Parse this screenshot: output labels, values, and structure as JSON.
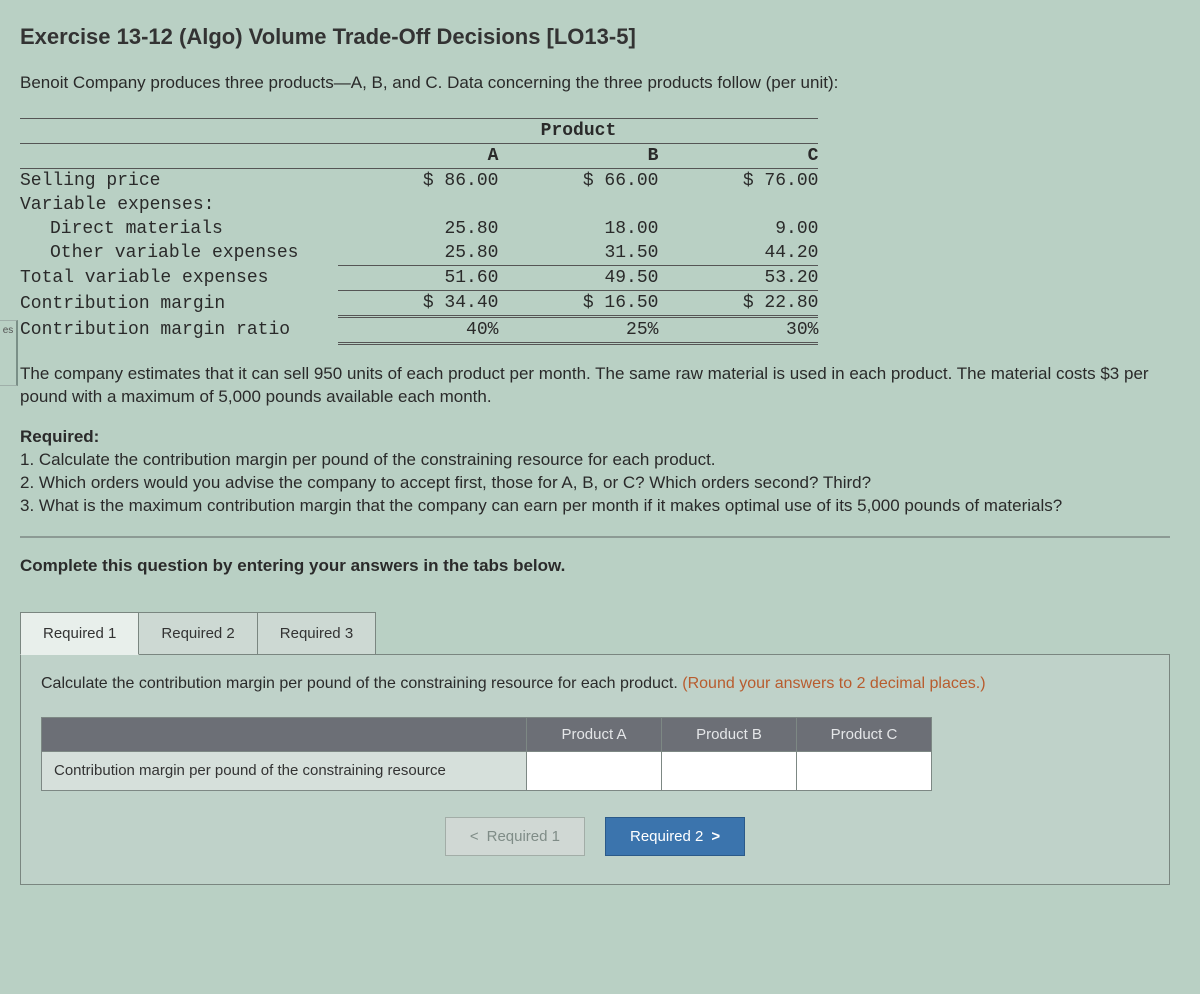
{
  "left_tab_text": "es",
  "title": "Exercise 13-12 (Algo) Volume Trade-Off Decisions [LO13-5]",
  "lead": "Benoit Company produces three products—A, B, and C. Data concerning the three products follow (per unit):",
  "product_header": "Product",
  "cols": [
    "A",
    "B",
    "C"
  ],
  "rows": {
    "selling": {
      "label": "Selling price",
      "vals": [
        "$ 86.00",
        "$ 66.00",
        "$ 76.00"
      ]
    },
    "varhdr": {
      "label": "Variable expenses:"
    },
    "dm": {
      "label": "Direct materials",
      "vals": [
        "25.80",
        "18.00",
        "9.00"
      ]
    },
    "ove": {
      "label": "Other variable expenses",
      "vals": [
        "25.80",
        "31.50",
        "44.20"
      ]
    },
    "tve": {
      "label": "Total variable expenses",
      "vals": [
        "51.60",
        "49.50",
        "53.20"
      ]
    },
    "cm": {
      "label": "Contribution margin",
      "vals": [
        "$ 34.40",
        "$ 16.50",
        "$ 22.80"
      ]
    },
    "cmr": {
      "label": "Contribution margin ratio",
      "vals": [
        "40%",
        "25%",
        "30%"
      ]
    }
  },
  "body2": "The company estimates that it can sell 950 units of each product per month. The same raw material is used in each product. The material costs $3 per pound with a maximum of 5,000 pounds available each month.",
  "req_hd": "Required:",
  "req_items": [
    "1. Calculate the contribution margin per pound of the constraining resource for each product.",
    "2. Which orders would you advise the company to accept first, those for A, B, or C? Which orders second? Third?",
    "3. What is the maximum contribution margin that the company can earn per month if it makes optimal use of its 5,000 pounds of materials?"
  ],
  "complete": "Complete this question by entering your answers in the tabs below.",
  "tabs": [
    "Required 1",
    "Required 2",
    "Required 3"
  ],
  "panel": {
    "prompt_main": "Calculate the contribution margin per pound of the constraining resource for each product. ",
    "prompt_hint": "(Round your answers to 2 decimal places.)",
    "row_label": "Contribution margin per pound of the constraining resource",
    "col_labels": [
      "Product A",
      "Product B",
      "Product C"
    ]
  },
  "nav": {
    "prev": "Required 1",
    "next": "Required 2"
  }
}
